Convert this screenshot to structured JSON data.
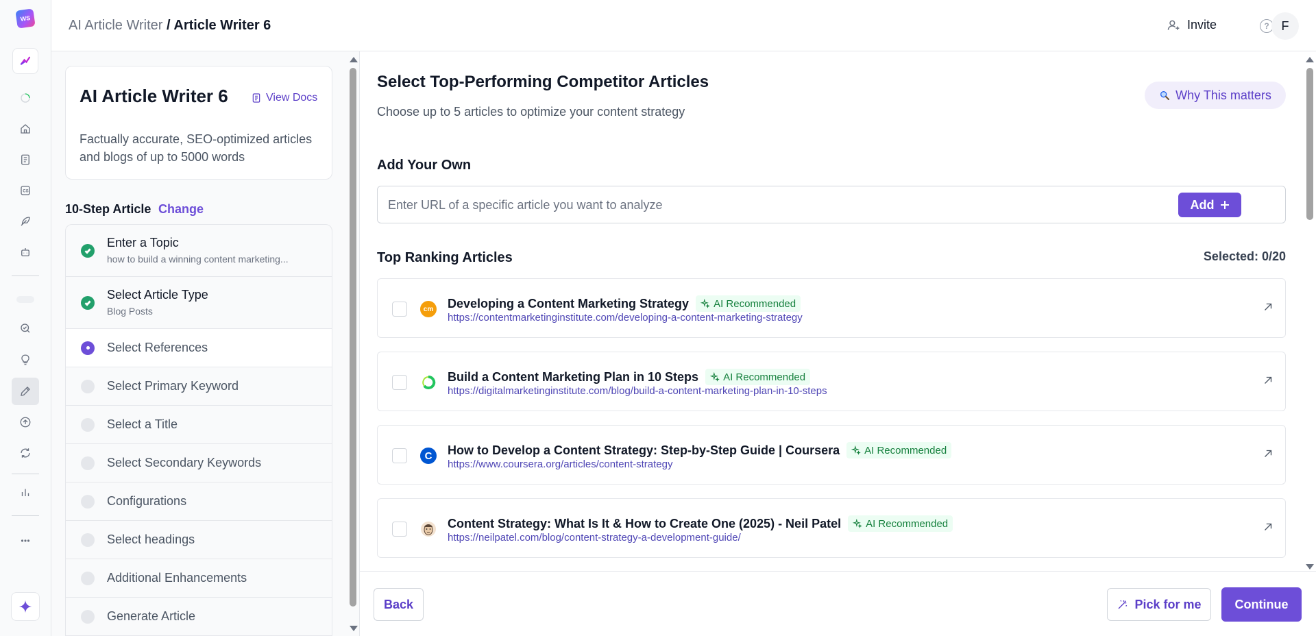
{
  "rail": {
    "logo_text": "WS",
    "icons": [
      "brand-icon",
      "loading-icon",
      "home-icon",
      "document-icon",
      "cs-icon",
      "feather-icon",
      "bot-icon",
      "search-check-icon",
      "lightbulb-icon",
      "pencil-icon",
      "upload-icon",
      "refresh-icon",
      "bar-chart-icon",
      "more-icon",
      "sparkle-icon"
    ]
  },
  "header": {
    "breadcrumb_parent": "AI Article Writer",
    "breadcrumb_sep": " / ",
    "breadcrumb_current": "Article Writer 6",
    "invite_label": "Invite",
    "help_glyph": "?",
    "avatar_initial": "F"
  },
  "info_card": {
    "title": "AI Article Writer 6",
    "view_docs_label": "View Docs",
    "description": "Factually accurate, SEO-optimized articles and blogs of up to 5000 words"
  },
  "steps_header": {
    "label": "10-Step Article",
    "change_label": "Change"
  },
  "steps": [
    {
      "label": "Enter a Topic",
      "sub": "how to build a winning content marketing...",
      "status": "done"
    },
    {
      "label": "Select Article Type",
      "sub": "Blog Posts",
      "status": "done"
    },
    {
      "label": "Select References",
      "sub": "",
      "status": "current"
    },
    {
      "label": "Select Primary Keyword",
      "sub": "",
      "status": "pending"
    },
    {
      "label": "Select a Title",
      "sub": "",
      "status": "pending"
    },
    {
      "label": "Select Secondary Keywords",
      "sub": "",
      "status": "pending"
    },
    {
      "label": "Configurations",
      "sub": "",
      "status": "pending"
    },
    {
      "label": "Select headings",
      "sub": "",
      "status": "pending"
    },
    {
      "label": "Additional Enhancements",
      "sub": "",
      "status": "pending"
    },
    {
      "label": "Generate Article",
      "sub": "",
      "status": "pending"
    }
  ],
  "main": {
    "title": "Select Top-Performing Competitor Articles",
    "subtitle": "Choose up to 5 articles to optimize your content strategy",
    "why_label": "Why This matters",
    "add_own_label": "Add Your Own",
    "url_placeholder": "Enter URL of a specific article you want to analyze",
    "url_value": "",
    "add_button_label": "Add",
    "top_ranking_label": "Top Ranking Articles",
    "selected_text": "Selected: 0/20"
  },
  "articles": [
    {
      "title": "Developing a Content Marketing Strategy",
      "badge": "AI Recommended",
      "url": "https://contentmarketinginstitute.com/developing-a-content-marketing-strategy",
      "favicon_text": "cm",
      "favicon_color": "#f59e0b",
      "checked": false
    },
    {
      "title": "Build a Content Marketing Plan in 10 Steps",
      "badge": "AI Recommended",
      "url": "https://digitalmarketinginstitute.com/blog/build-a-content-marketing-plan-in-10-steps",
      "favicon_text": "",
      "favicon_color": "#22c55e",
      "checked": false
    },
    {
      "title": "How to Develop a Content Strategy: Step-by-Step Guide | Coursera",
      "badge": "AI Recommended",
      "url": "https://www.coursera.org/articles/content-strategy",
      "favicon_text": "C",
      "favicon_color": "#0056d2",
      "checked": false
    },
    {
      "title": "Content Strategy: What Is It & How to Create One (2025) - Neil Patel",
      "badge": "AI Recommended",
      "url": "https://neilpatel.com/blog/content-strategy-a-development-guide/",
      "favicon_text": "",
      "favicon_color": "#f3e2d0",
      "checked": false
    }
  ],
  "footer": {
    "back_label": "Back",
    "pick_label": "Pick for me",
    "continue_label": "Continue"
  },
  "colors": {
    "accent": "#6d4ed8",
    "success": "#22a06b",
    "badge_bg": "#ecfdf3",
    "badge_text": "#15803d"
  }
}
